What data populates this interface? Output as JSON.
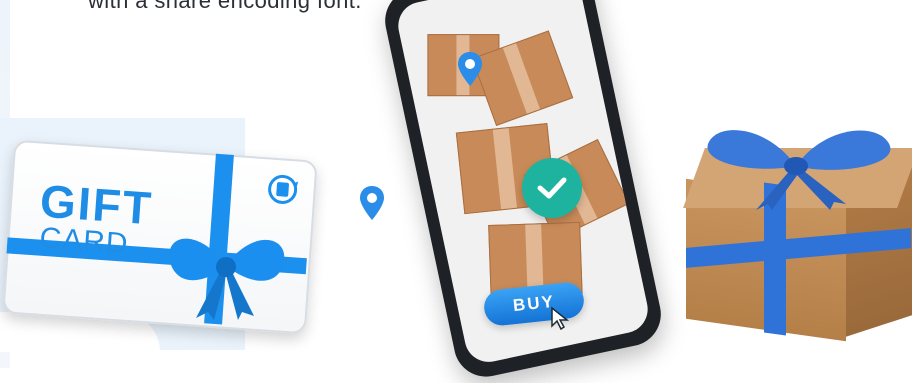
{
  "header": {
    "text": "with a share encoding  font."
  },
  "gift_card": {
    "gift_label": "GIFT",
    "card_label": "CARD",
    "icon": "refresh-card-icon"
  },
  "phone": {
    "buy_label": "BUY",
    "badge_icon": "checkmark-icon",
    "pin_icon": "location-pin-icon",
    "cursor_icon": "cursor-arrow-icon"
  },
  "gift_box": {
    "icon": "gift-bow-icon"
  },
  "colors": {
    "accent_blue": "#1b90ee",
    "teal": "#1eb39f",
    "kraft": "#c9955f"
  }
}
